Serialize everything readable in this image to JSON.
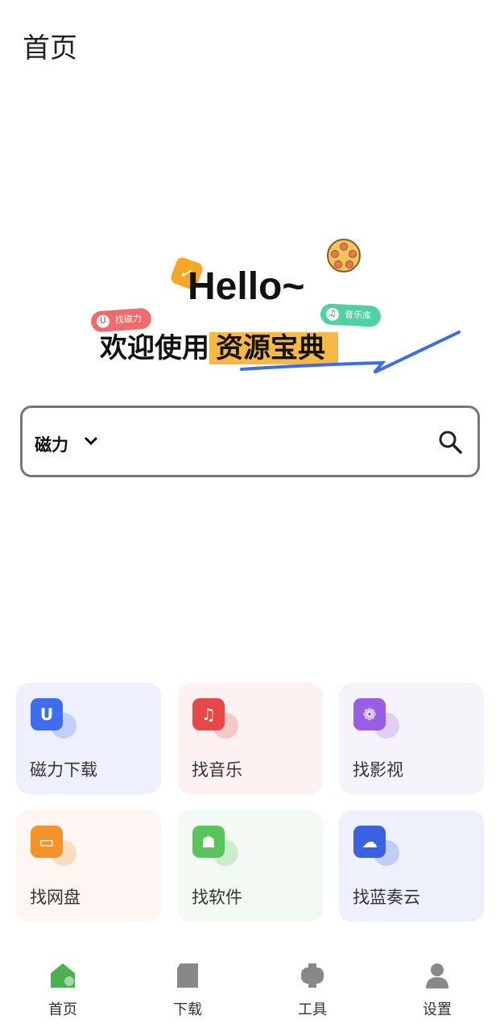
{
  "header": {
    "title": "首页"
  },
  "banner": {
    "hello": "Hello~",
    "welcome": "欢迎使用",
    "brand": "资源宝典",
    "tag_magnet": "找磁力",
    "tag_music": "音乐库"
  },
  "search": {
    "type": "磁力",
    "value": "",
    "placeholder": ""
  },
  "cards": [
    {
      "label": "磁力下载",
      "icon": "magnet-icon",
      "color": "#3d6ef0",
      "bg": "#eef1fd"
    },
    {
      "label": "找音乐",
      "icon": "music-icon",
      "color": "#e84848",
      "bg": "#fdf1f1"
    },
    {
      "label": "找影视",
      "icon": "film-icon",
      "color": "#9a5ee6",
      "bg": "#f6f3fb"
    },
    {
      "label": "找网盘",
      "icon": "folder-icon",
      "color": "#f5932a",
      "bg": "#fdf6f3"
    },
    {
      "label": "找软件",
      "icon": "android-icon",
      "color": "#58c45a",
      "bg": "#f3faf4"
    },
    {
      "label": "找蓝奏云",
      "icon": "cloud-search-icon",
      "color": "#3a62e0",
      "bg": "#eef0fc"
    }
  ],
  "nav": [
    {
      "label": "首页",
      "icon": "home-icon",
      "active": true
    },
    {
      "label": "下载",
      "icon": "download-icon"
    },
    {
      "label": "工具",
      "icon": "toolbox-icon"
    },
    {
      "label": "设置",
      "icon": "user-icon"
    }
  ],
  "colors": {
    "accent": "#4caf50",
    "nav_inactive": "#888888"
  }
}
